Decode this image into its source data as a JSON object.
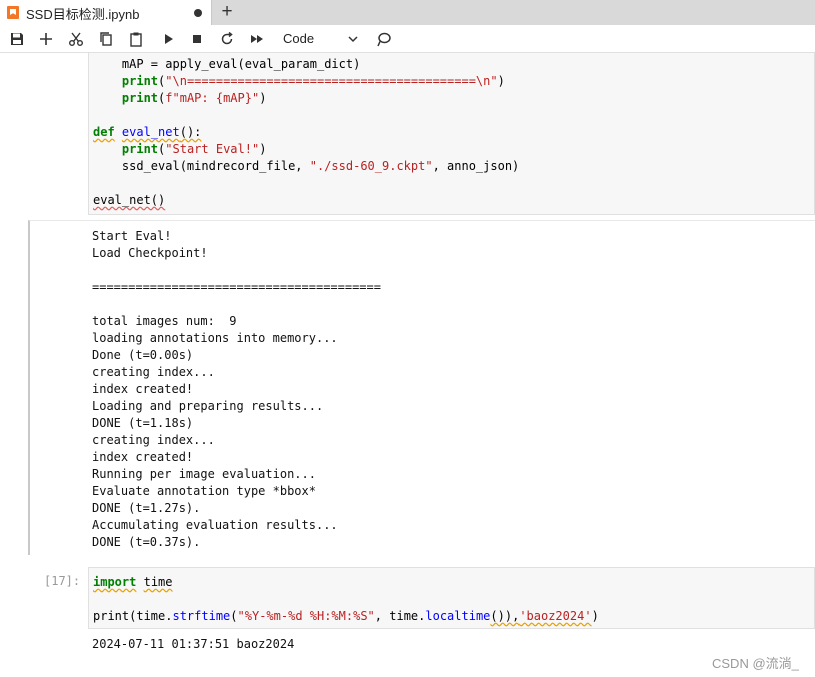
{
  "tab": {
    "title": "SSD目标检测.ipynb"
  },
  "toolbar": {
    "cell_type": "Code"
  },
  "cell1": {
    "lines": [
      "    mAP = apply_eval(eval_param_dict)",
      "    print(\"\\n========================================\\n\")",
      "    print(f\"mAP: {mAP}\")",
      "",
      "def eval_net():",
      "    print(\"Start Eval!\")",
      "    ssd_eval(mindrecord_file, \"./ssd-60_9.ckpt\", anno_json)",
      "",
      "eval_net()"
    ]
  },
  "output1": {
    "lines": [
      "Start Eval!",
      "Load Checkpoint!",
      "",
      "========================================",
      "",
      "total images num:  9",
      "loading annotations into memory...",
      "Done (t=0.00s)",
      "creating index...",
      "index created!",
      "Loading and preparing results...",
      "DONE (t=1.18s)",
      "creating index...",
      "index created!",
      "Running per image evaluation...",
      "Evaluate annotation type *bbox*",
      "DONE (t=1.27s).",
      "Accumulating evaluation results...",
      "DONE (t=0.37s)."
    ]
  },
  "cell2": {
    "prompt": "[17]:",
    "line1_kw": "import",
    "line1_mod": "time",
    "line2": {
      "p1": "print(time.",
      "p2": "strftime",
      "p3": "(",
      "p4": "\"%Y-%m-%d %H:%M:%S\"",
      "p5": ", time.",
      "p6": "localtime",
      "p7": "()),",
      "p8": "'baoz2024'",
      "p9": ")"
    }
  },
  "output2": {
    "text": "2024-07-11 01:37:51 baoz2024"
  },
  "watermark": "CSDN @流淌_"
}
